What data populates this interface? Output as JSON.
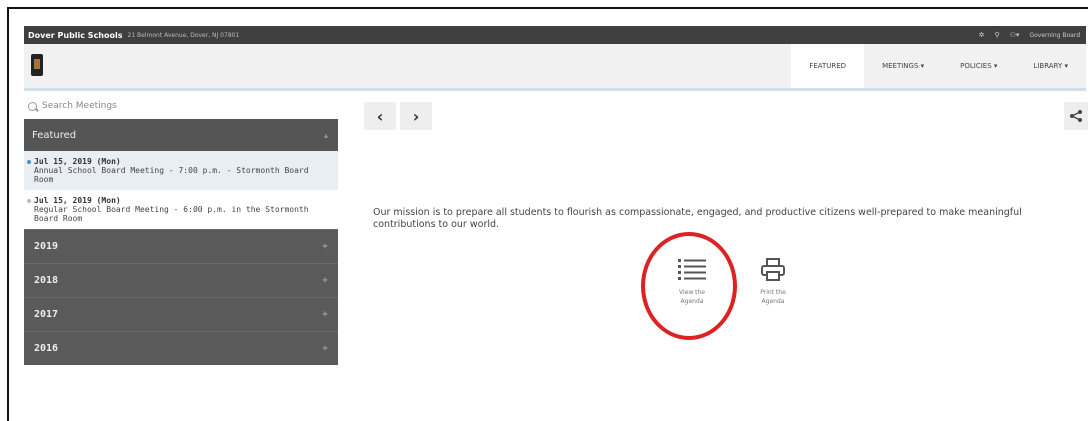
{
  "topbar": {
    "district": "Dover Public Schools",
    "address": "21 Belmont Avenue, Dover, NJ 07801",
    "account": "Governing Board"
  },
  "nav": {
    "items": [
      "FEATURED",
      "MEETINGS ▾",
      "POLICIES ▾",
      "LIBRARY ▾"
    ]
  },
  "sidebar": {
    "search_placeholder": "Search Meetings",
    "featured_label": "Featured",
    "meetings": [
      {
        "date": "Jul 15, 2019 (Mon)",
        "title": "Annual School Board Meeting - 7:00 p.m. - Stormonth Board Room"
      },
      {
        "date": "Jul 15, 2019 (Mon)",
        "title": "Regular School Board Meeting - 6:00 p.m. in the Stormonth Board Room"
      }
    ],
    "years": [
      "2019",
      "2018",
      "2017",
      "2016"
    ]
  },
  "main": {
    "mission": "Our mission is to prepare all students to flourish as compassionate, engaged, and productive citizens well-prepared to make meaningful contributions to our world.",
    "view_agenda": "View the Agenda",
    "print_agenda": "Print the Agenda"
  },
  "colors": {
    "topbar": "#3f3f3f",
    "sidebar_header": "#555555",
    "highlight_circle": "#dd2222"
  }
}
